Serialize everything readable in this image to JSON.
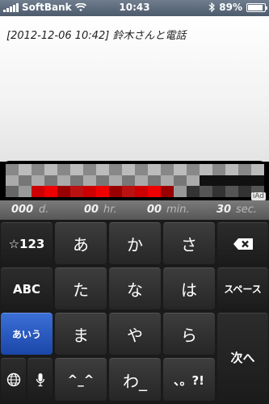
{
  "status_bar": {
    "carrier": "SoftBank",
    "time": "10:43",
    "battery": "89%",
    "battery_level": 0.89
  },
  "note": {
    "text": "[2012-12-06  10:42]  鈴木さんと電話"
  },
  "ad": {
    "label": "iAd"
  },
  "timer": {
    "days": "000",
    "days_unit": "d.",
    "hours": "00",
    "hours_unit": "hr.",
    "minutes": "00",
    "minutes_unit": "min.",
    "seconds": "30",
    "seconds_unit": "sec."
  },
  "keyboard": {
    "symbols_key": "☆123",
    "a_key": "あ",
    "ka_key": "か",
    "sa_key": "さ",
    "abc_key": "ABC",
    "ta_key": "た",
    "na_key": "な",
    "ha_key": "は",
    "space_key": "スペース",
    "kana_mode_key": "あいう",
    "ma_key": "ま",
    "ya_key": "や",
    "ra_key": "ら",
    "next_key": "次へ",
    "emoticon_key": "^_^",
    "wa_key": "わ_",
    "punct_key": "、。?!"
  }
}
